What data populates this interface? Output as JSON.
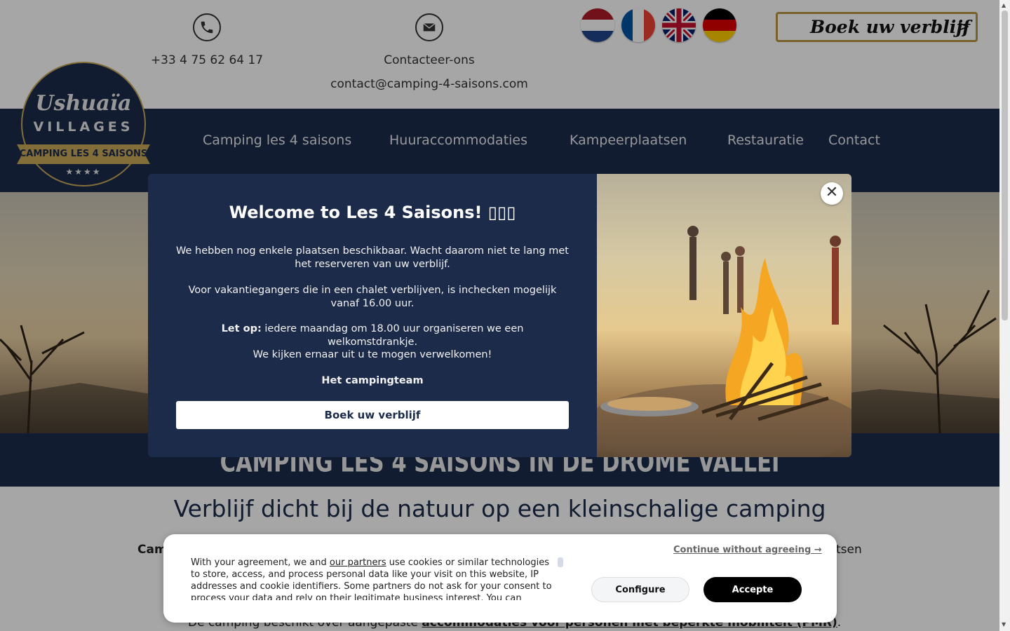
{
  "header": {
    "phone_number": "+33 4 75 62 64 17",
    "contact_label": "Contacteer-ons",
    "contact_email": "contact@camping-4-saisons.com",
    "phone_icon": "phone-icon",
    "mail_icon": "mail-icon",
    "flags": [
      {
        "lang": "nl",
        "icon": "flag-netherlands-icon"
      },
      {
        "lang": "fr",
        "icon": "flag-france-icon"
      },
      {
        "lang": "en",
        "icon": "flag-uk-icon"
      },
      {
        "lang": "de",
        "icon": "flag-germany-icon"
      }
    ],
    "book_label": "Boek uw verblijf",
    "book_chevron": ">"
  },
  "logo": {
    "line1": "Ushuaïa",
    "line2": "VILLAGES",
    "ribbon": "CAMPING LES 4 SAISONS",
    "stars": "★★★★"
  },
  "nav": {
    "items": [
      "Camping les 4 saisons",
      "Huuraccommodaties",
      "Kampeerplaatsen",
      "Restauratie",
      "Contact"
    ]
  },
  "hero": {
    "subtitle": "CAMPING LES 4 SAISONS IN DE DRÔME VALLEI"
  },
  "intro": {
    "heading": "Verblijf dicht bij de natuur op een kleinschalige camping",
    "line1_left": "Cam",
    "line1_right": "tsen",
    "line3_text": "De camping beschikt over aangepaste ",
    "line3_link": "accommodaties voor personen met beperkte mobiliteit (PMR)",
    "line3_end": "."
  },
  "modal": {
    "title": "Welcome to Les 4 Saisons! ",
    "title_glyphs": "▯▯▯",
    "p1": "We hebben nog enkele plaatsen beschikbaar. Wacht daarom niet te lang met het reserveren van uw verblijf.",
    "p2": "Voor vakantiegangers die in een chalet verblijven, is inchecken mogelijk vanaf 16.00 uur.",
    "p3_bold": "Let op:",
    "p3_text": " iedere maandag om 18.00 uur organiseren we een welkomstdrankje.",
    "p4": "We kijken ernaar uit u te mogen verwelkomen!",
    "p5": "Het campingteam",
    "book_button": "Boek uw verblijf",
    "close_glyph": "✕"
  },
  "cookie": {
    "text_before": "With your agreement, we and ",
    "partners_link": "our partners",
    "text_after": " use cookies or similar technologies to store, access, and process personal data like your visit on this website, IP addresses and cookie identifiers. Some partners do not ask for your consent to process your data and rely on their legitimate business interest. You can",
    "continue_label": "Continue without agreeing →",
    "configure_label": "Configure",
    "accept_label": "Accepte"
  },
  "colors": {
    "navy": "#1c2b4a",
    "gold": "#b89740",
    "accept_bg": "#000000"
  }
}
